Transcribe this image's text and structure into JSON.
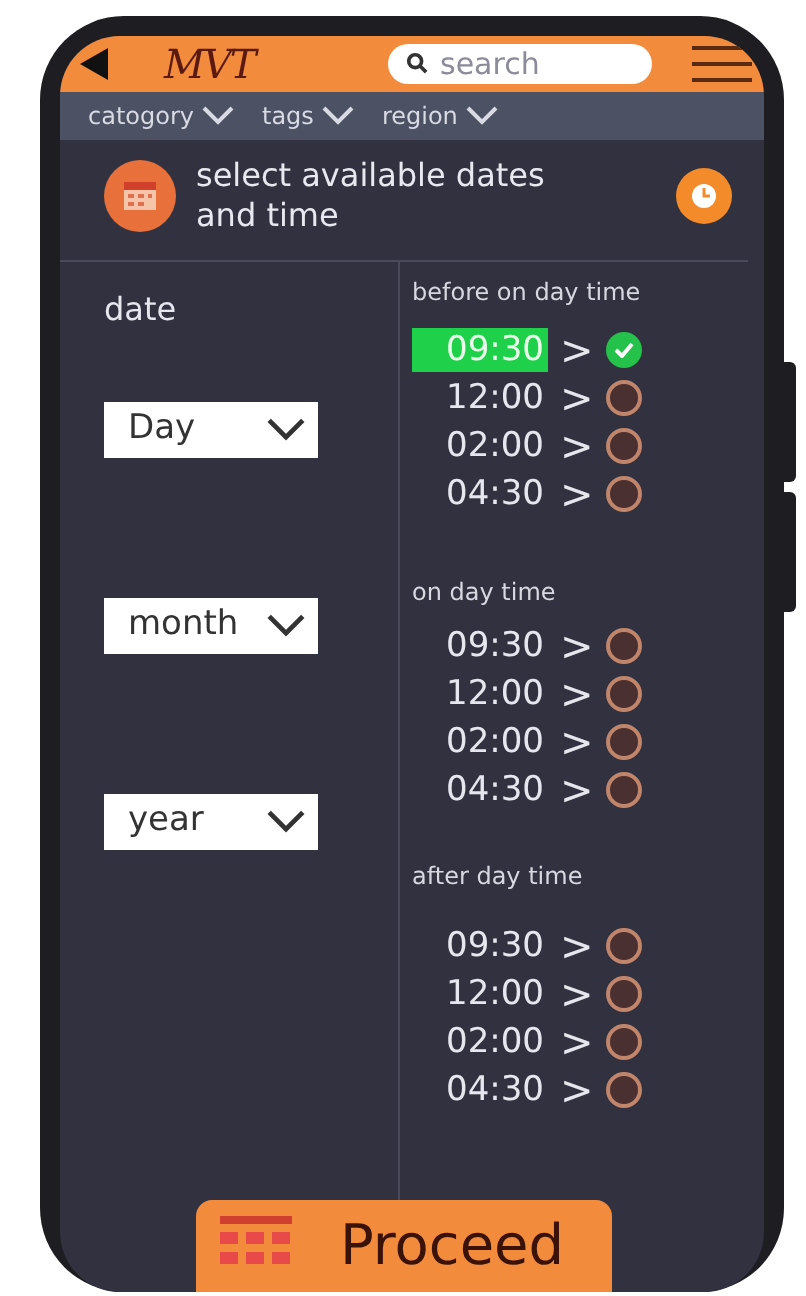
{
  "top_bar": {
    "logo": "MVT",
    "search": {
      "placeholder": "search"
    }
  },
  "filters": [
    {
      "label": "catogory"
    },
    {
      "label": "tags"
    },
    {
      "label": "region"
    }
  ],
  "header": {
    "title": "select available dates and time"
  },
  "date": {
    "label": "date",
    "selects": [
      {
        "value": "Day"
      },
      {
        "value": "month"
      },
      {
        "value": "year"
      }
    ]
  },
  "time_groups": [
    {
      "title": "before on day time",
      "slots": [
        {
          "time": "09:30",
          "arrow": ">",
          "selected": true
        },
        {
          "time": "12:00",
          "arrow": ">",
          "selected": false
        },
        {
          "time": "02:00",
          "arrow": ">",
          "selected": false
        },
        {
          "time": "04:30",
          "arrow": ">",
          "selected": false
        }
      ]
    },
    {
      "title": "on day time",
      "slots": [
        {
          "time": "09:30",
          "arrow": ">",
          "selected": false
        },
        {
          "time": "12:00",
          "arrow": ">",
          "selected": false
        },
        {
          "time": "02:00",
          "arrow": ">",
          "selected": false
        },
        {
          "time": "04:30",
          "arrow": ">",
          "selected": false
        }
      ]
    },
    {
      "title": "after day time",
      "slots": [
        {
          "time": "09:30",
          "arrow": ">",
          "selected": false
        },
        {
          "time": "12:00",
          "arrow": ">",
          "selected": false
        },
        {
          "time": "02:00",
          "arrow": ">",
          "selected": false
        },
        {
          "time": "04:30",
          "arrow": ">",
          "selected": false
        }
      ]
    }
  ],
  "proceed_button": {
    "label": "Proceed"
  }
}
